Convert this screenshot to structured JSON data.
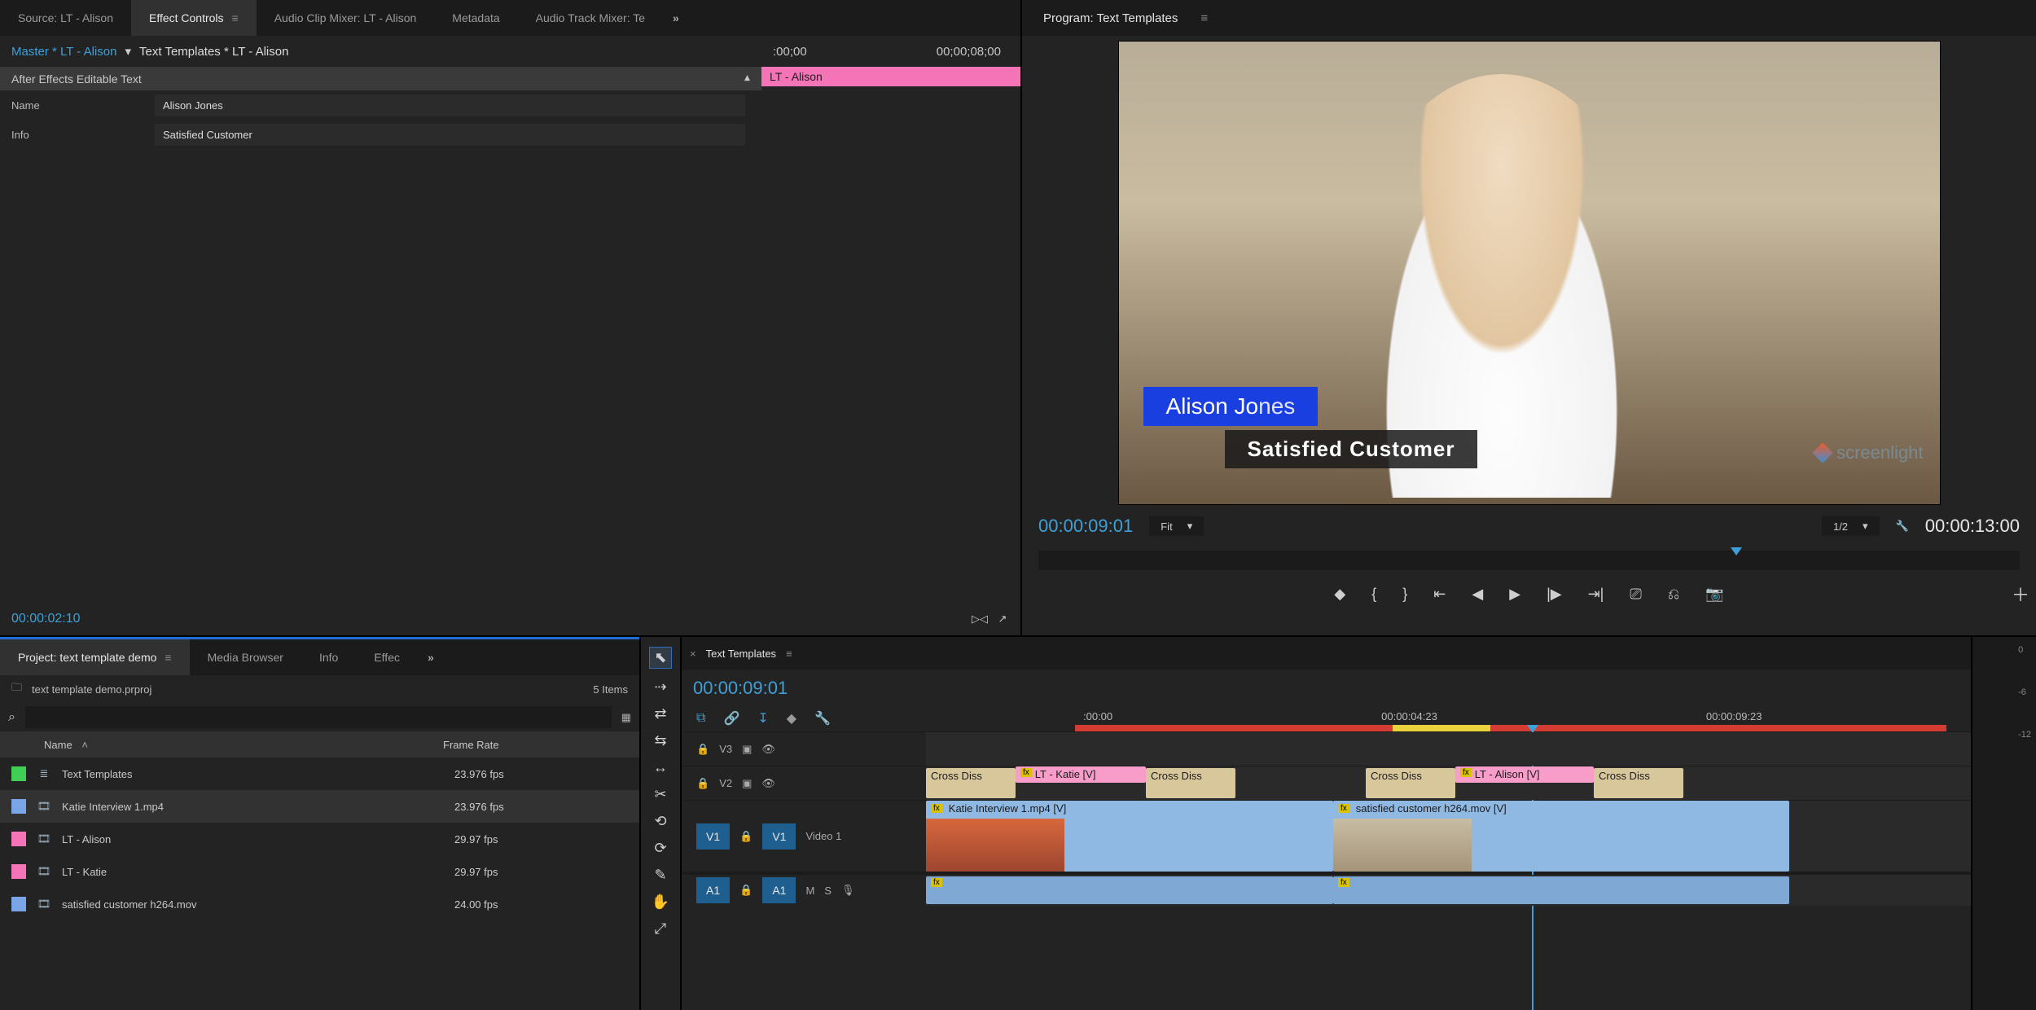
{
  "source_panel": {
    "tabs": {
      "source": "Source: LT - Alison",
      "effect_controls": "Effect Controls",
      "audio_clip_mixer": "Audio Clip Mixer: LT - Alison",
      "metadata": "Metadata",
      "audio_track_mixer": "Audio Track Mixer: Te",
      "overflow": "»"
    },
    "master_label": "Master * LT - Alison",
    "template_label": "Text Templates * LT - Alison",
    "tc_start": ":00;00",
    "tc_end": "00;00;08;00",
    "section_header": "After Effects Editable Text",
    "track_clip_label": "LT - Alison",
    "fields": {
      "name_label": "Name",
      "name_value": "Alison Jones",
      "info_label": "Info",
      "info_value": "Satisfied Customer"
    },
    "footer_tc": "00:00:02:10"
  },
  "program_panel": {
    "tab_label": "Program: Text Templates",
    "lower_third": {
      "name_pre": "Alison Jo",
      "name_sel": "nes",
      "info": "Satisfied Customer"
    },
    "watermark": "screenlight",
    "tc_left": "00:00:09:01",
    "fit_label": "Fit",
    "scale_label": "1/2",
    "tc_right": "00:00:13:00"
  },
  "project_panel": {
    "tabs": {
      "project": "Project: text template demo",
      "media_browser": "Media Browser",
      "info": "Info",
      "effects": "Effec",
      "overflow": "»"
    },
    "project_file": "text template demo.prproj",
    "item_count": "5 Items",
    "search_icon": "⌕",
    "headers": {
      "name": "Name",
      "frame_rate": "Frame Rate"
    },
    "items": [
      {
        "swatch": "green",
        "icon": "≣",
        "name": "Text Templates",
        "fps": "23.976 fps"
      },
      {
        "swatch": "blue",
        "icon": "🎞",
        "name": "Katie Interview 1.mp4",
        "fps": "23.976 fps"
      },
      {
        "swatch": "pink",
        "icon": "🎞",
        "name": "LT - Alison",
        "fps": "29.97 fps"
      },
      {
        "swatch": "pink",
        "icon": "🎞",
        "name": "LT - Katie",
        "fps": "29.97 fps"
      },
      {
        "swatch": "blue",
        "icon": "🎞",
        "name": "satisfied customer h264.mov",
        "fps": "24.00 fps"
      }
    ]
  },
  "timeline": {
    "tab_label": "Text Templates",
    "tc": "00:00:09:01",
    "ruler": [
      ":00:00",
      "00:00:04:23",
      "00:00:09:23"
    ],
    "tracks": {
      "v3": "V3",
      "v2": "V2",
      "v1": "V1",
      "video1": "Video 1",
      "a1": "A1"
    },
    "clips": {
      "lt_katie": "LT - Katie [V]",
      "lt_alison": "LT - Alison [V]",
      "cross1": "Cross Diss",
      "cross2": "Cross Diss",
      "cross3": "Cross Diss",
      "cross4": "Cross Diss",
      "katie_v": "Katie Interview 1.mp4 [V]",
      "sat_v": "satisfied customer h264.mov [V]"
    }
  },
  "meters": {
    "m0": "0",
    "m6": "-6",
    "m12": "-12"
  },
  "glyphs": {
    "menu": "≡",
    "caret_down": "▾",
    "caret_right": "▸",
    "folder": "🗀",
    "bin": "▦",
    "mark_in": "{",
    "mark_out": "}",
    "step_back": "⇤",
    "play_rev": "◀",
    "play": "▶",
    "step_fwd": "⇥",
    "go_end": "⇥|",
    "lift": "⎚",
    "extract": "⎌",
    "camera": "📷",
    "plus": "＋",
    "wrench": "🔧",
    "lock": "🔒",
    "eye": "👁",
    "mute": "M",
    "solo": "S",
    "mic": "🎙",
    "sel": "⬉",
    "trackfwd": "⇢",
    "ripple": "⇄",
    "roll": "⇆",
    "rate": "↔",
    "razor": "✂",
    "slip": "⟲",
    "slide": "⟳",
    "pen": "✎",
    "hand": "✋",
    "zoom": "⤢",
    "snap": "⧉",
    "marker": "◆",
    "link": "🔗",
    "settings": "☰",
    "insert": "↧",
    "overwrite": "↦",
    "fx": "fx"
  }
}
